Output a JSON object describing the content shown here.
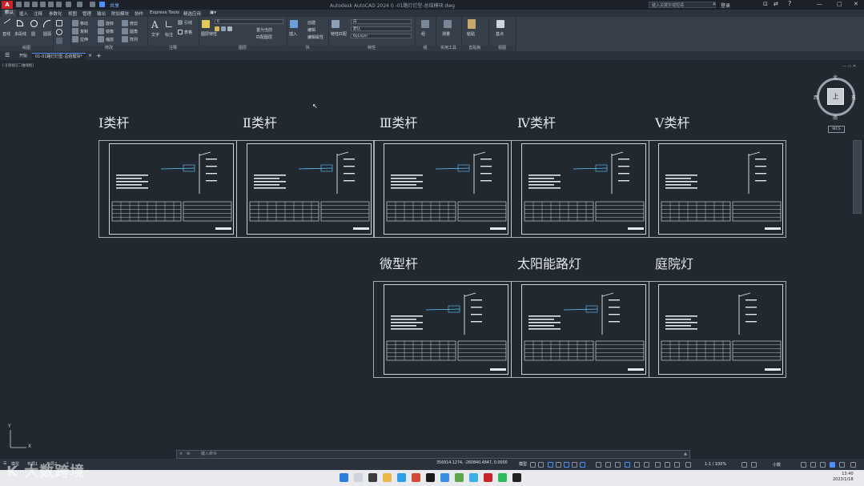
{
  "app": {
    "window_title": "Autodesk AutoCAD 2024    0 -01路灯灯型-总结模块.dwg",
    "logo_letter": "A",
    "share_label": "共享",
    "search_placeholder": "键入关键字或短语",
    "login_label": "登录",
    "window_controls": [
      "—",
      "□",
      "✕"
    ]
  },
  "ribbon_tabs": [
    "默认",
    "插入",
    "注释",
    "参数化",
    "视图",
    "管理",
    "输出",
    "附加模块",
    "协作",
    "Express Tools",
    "精选应用",
    "▣▾"
  ],
  "ribbon_active_tab": "默认",
  "ribbon": {
    "draw": {
      "label": "绘图",
      "buttons": [
        "直线",
        "多段线",
        "圆",
        "圆弧"
      ]
    },
    "modify": {
      "label": "修改",
      "buttons": [
        "移动",
        "旋转",
        "修剪",
        "复制",
        "镜像",
        "圆角",
        "拉伸",
        "缩放",
        "阵列"
      ]
    },
    "annotation": {
      "label": "注释",
      "buttons": [
        "文字",
        "标注",
        "引线",
        "表格"
      ]
    },
    "layers": {
      "label": "图层",
      "current": "0",
      "buttons": [
        "图层特性",
        "置为当前",
        "匹配图层"
      ]
    },
    "block": {
      "label": "块",
      "buttons": [
        "插入",
        "创建",
        "编辑",
        "编辑属性"
      ]
    },
    "properties": {
      "label": "特性",
      "color": "白",
      "linetype": "默认",
      "lineweight": "ByLayer",
      "buttons": [
        "特性匹配"
      ]
    },
    "groups": {
      "label": "组",
      "buttons": [
        "组"
      ]
    },
    "utilities": {
      "label": "实用工具",
      "buttons": [
        "测量"
      ]
    },
    "clipboard": {
      "label": "剪贴板",
      "buttons": [
        "粘贴"
      ]
    },
    "view": {
      "label": "视图",
      "buttons": [
        "基点"
      ]
    }
  },
  "file_tabs": [
    {
      "label": "开始",
      "active": false
    },
    {
      "label": "01-01路灯灯型-总结模块*",
      "active": true
    }
  ],
  "viewport_label": "[-][俯视][二维线框]",
  "sheets": [
    {
      "label": "Ⅰ类杆"
    },
    {
      "label": "Ⅱ类杆"
    },
    {
      "label": "Ⅲ类杆"
    },
    {
      "label": "Ⅳ类杆"
    },
    {
      "label": "Ⅴ类杆"
    },
    {
      "label": "微型杆"
    },
    {
      "label": "太阳能路灯"
    },
    {
      "label": "庭院灯"
    }
  ],
  "viewcube": {
    "north": "北",
    "south": "南",
    "east": "东",
    "west": "西",
    "face": "上",
    "wcs": "WCS"
  },
  "ucs": {
    "x": "X",
    "y": "Y"
  },
  "command_placeholder": "键入命令",
  "layout_tabs": [
    "模型",
    "布局1",
    "布局2",
    "+"
  ],
  "status": {
    "coordinates": "356914.1274, -260840.4847, 0.0000",
    "model": "模型",
    "scale": "1:1 / 100%",
    "units": "小数"
  },
  "watermark": "K 大数跨境",
  "taskbar": {
    "time": "13:40",
    "date": "2023/1/18"
  }
}
